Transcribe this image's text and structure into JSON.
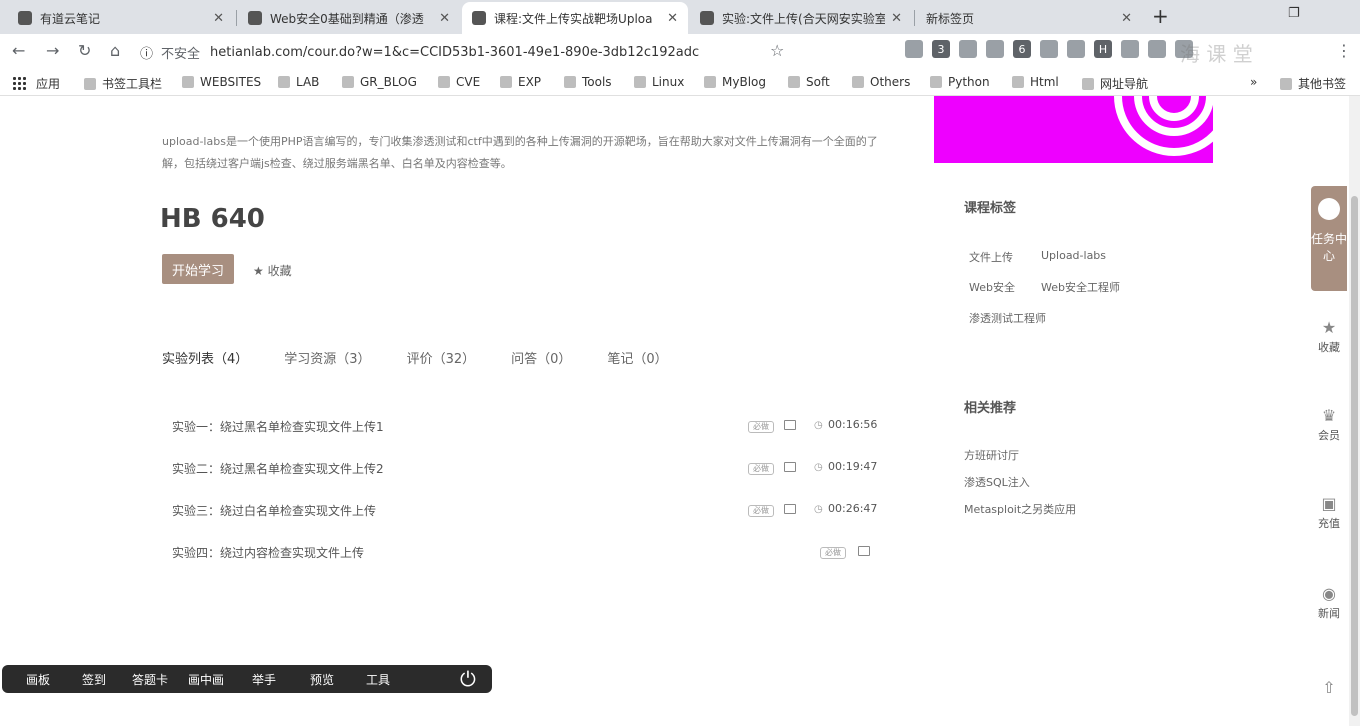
{
  "browser": {
    "tabs": [
      {
        "title": "有道云笔记",
        "active": false
      },
      {
        "title": "Web安全0基础到精通（渗透",
        "active": false
      },
      {
        "title": "课程:文件上传实战靶场Uploa",
        "active": true
      },
      {
        "title": "实验:文件上传(合天网安实验室",
        "active": false
      },
      {
        "title": "新标签页",
        "active": false
      }
    ],
    "new_tab": "+",
    "address": {
      "insecure_label": "不安全",
      "url": "hetianlab.com/cour.do?w=1&c=CCID53b1-3601-49e1-890e-3db12c192adc"
    },
    "extension_badges": [
      "3",
      "6"
    ],
    "bookmarks": [
      "应用",
      "书签工具栏",
      "WEBSITES",
      "LAB",
      "GR_BLOG",
      "CVE",
      "EXP",
      "Tools",
      "Linux",
      "MyBlog",
      "Soft",
      "Others",
      "Python",
      "Html",
      "网址导航"
    ],
    "bookmarks_more": "»",
    "other_bookmarks": "其他书签",
    "watermark": "海 课 堂"
  },
  "course": {
    "desc": "upload-labs是一个使用PHP语言编写的，专门收集渗透测试和ctf中遇到的各种上传漏洞的开源靶场，旨在帮助大家对文件上传漏洞有一个全面的了解，包括绕过客户端js检查、绕过服务端黑名单、白名单及内容检查等。",
    "price": "HB 640",
    "start_button": "开始学习",
    "favorite": "收藏",
    "tabs": [
      "实验列表（4）",
      "学习资源（3）",
      "评价（32）",
      "问答（0）",
      "笔记（0）"
    ],
    "labs": [
      {
        "name": "实验一：绕过黑名单检查实现文件上传1",
        "badge": "必做",
        "duration": "00:16:56"
      },
      {
        "name": "实验二：绕过黑名单检查实现文件上传2",
        "badge": "必做",
        "duration": "00:19:47"
      },
      {
        "name": "实验三：绕过白名单检查实现文件上传",
        "badge": "必做",
        "duration": "00:26:47"
      },
      {
        "name": "实验四：绕过内容检查实现文件上传",
        "badge": "必做",
        "duration": ""
      }
    ]
  },
  "sidebar": {
    "tags_title": "课程标签",
    "tags": [
      "文件上传",
      "Upload-labs",
      "Web安全",
      "Web安全工程师",
      "渗透测试工程师"
    ],
    "rec_title": "相关推荐",
    "recommendations": [
      "方班研讨厅",
      "渗透SQL注入",
      "Metasploit之另类应用"
    ]
  },
  "floating": {
    "task_center": "任务中心",
    "favorites": "收藏",
    "member": "会员",
    "recharge": "充值",
    "news": "新闻",
    "top": "⇧"
  },
  "live_toolbar": [
    "画板",
    "签到",
    "答题卡",
    "画中画",
    "举手",
    "预览",
    "工具"
  ],
  "colors": {
    "accent": "#a88f80",
    "promo": "#ee00ff",
    "toolbar_dark": "#2b2b2b"
  }
}
